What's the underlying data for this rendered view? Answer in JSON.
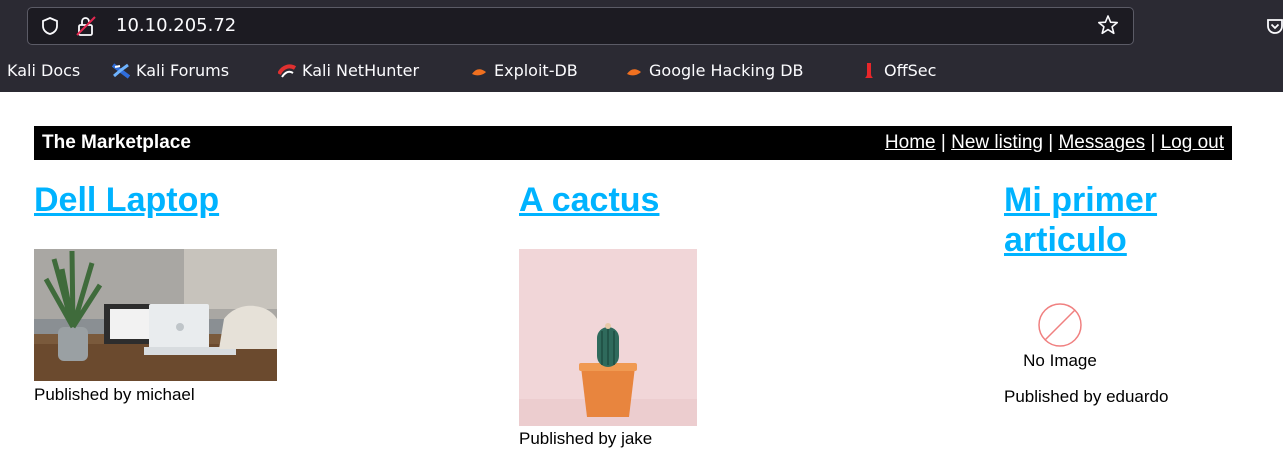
{
  "browser": {
    "url": "10.10.205.72",
    "bookmarks": [
      {
        "label": "Kali Docs",
        "icon": "kali-docs-icon"
      },
      {
        "label": "Kali Forums",
        "icon": "kali-forums-icon"
      },
      {
        "label": "Kali NetHunter",
        "icon": "kali-nethunter-icon"
      },
      {
        "label": "Exploit-DB",
        "icon": "exploit-db-icon"
      },
      {
        "label": "Google Hacking DB",
        "icon": "ghdb-icon"
      },
      {
        "label": "OffSec",
        "icon": "offsec-icon"
      }
    ]
  },
  "site": {
    "brand": "The Marketplace",
    "nav": {
      "home": "Home",
      "new_listing": "New listing",
      "messages": "Messages",
      "logout": "Log out",
      "separator": "|"
    }
  },
  "listings": [
    {
      "title": "Dell Laptop",
      "published": "Published by michael",
      "image": "laptop-photo"
    },
    {
      "title": "A cactus",
      "published": "Published by jake",
      "image": "cactus-photo"
    },
    {
      "title_line1": "Mi primer",
      "title_line2": "articulo",
      "published": "Published by eduardo",
      "image_alt": "No Image"
    }
  ],
  "colors": {
    "link": "#00b3ff",
    "navbar": "#000000",
    "chrome": "#2b2a33"
  }
}
